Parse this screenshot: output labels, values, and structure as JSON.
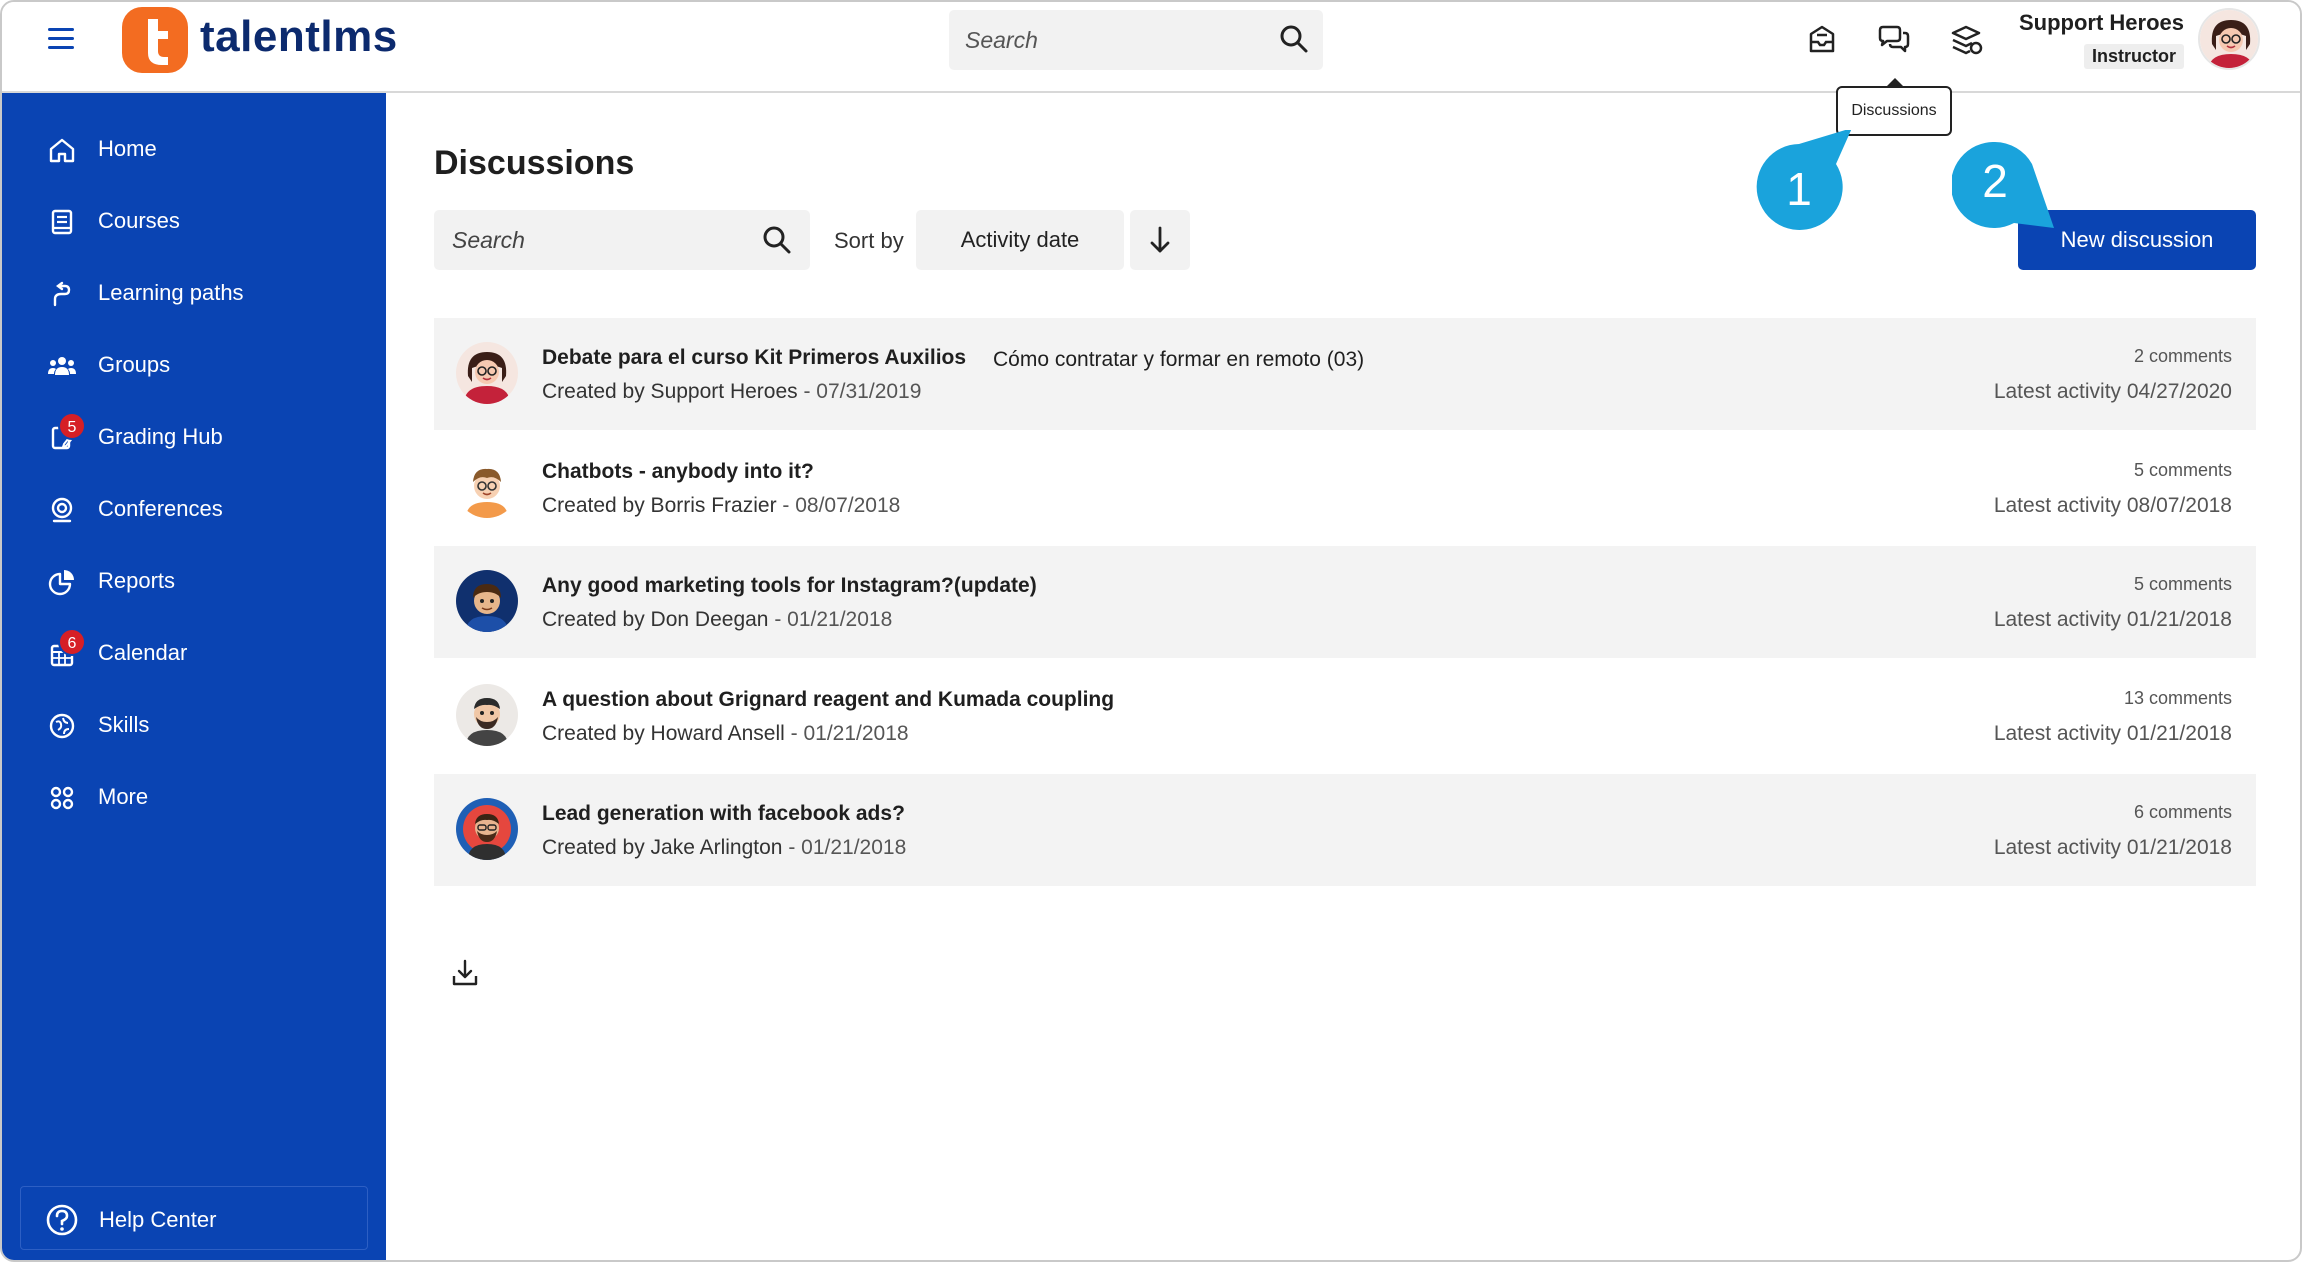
{
  "header": {
    "brand": "talentlms",
    "search_placeholder": "Search",
    "user_name": "Support Heroes",
    "user_role": "Instructor",
    "tooltip": "Discussions"
  },
  "sidebar": {
    "items": [
      {
        "label": "Home",
        "icon": "home-icon"
      },
      {
        "label": "Courses",
        "icon": "courses-icon"
      },
      {
        "label": "Learning paths",
        "icon": "learning-paths-icon"
      },
      {
        "label": "Groups",
        "icon": "groups-icon"
      },
      {
        "label": "Grading Hub",
        "icon": "grading-hub-icon",
        "badge": "5"
      },
      {
        "label": "Conferences",
        "icon": "conferences-icon"
      },
      {
        "label": "Reports",
        "icon": "reports-icon"
      },
      {
        "label": "Calendar",
        "icon": "calendar-icon",
        "badge": "6"
      },
      {
        "label": "Skills",
        "icon": "skills-icon"
      },
      {
        "label": "More",
        "icon": "more-icon"
      }
    ],
    "help_label": "Help Center"
  },
  "main": {
    "title": "Discussions",
    "search_placeholder": "Search",
    "sort_label": "Sort by",
    "sort_value": "Activity date",
    "new_button": "New discussion",
    "callouts": [
      "1",
      "2"
    ],
    "discussions": [
      {
        "title": "Debate para el curso Kit Primeros Auxilios",
        "course": "Cómo contratar y formar en remoto (03)",
        "author": "Created by Support Heroes",
        "date": " - 07/31/2019",
        "comments": "2 comments",
        "activity": "Latest activity 04/27/2020"
      },
      {
        "title": "Chatbots - anybody into it?",
        "course": "",
        "author": "Created by Borris Frazier",
        "date": " - 08/07/2018",
        "comments": "5 comments",
        "activity": "Latest activity 08/07/2018"
      },
      {
        "title": "Any good marketing tools for Instagram?(update)",
        "course": "",
        "author": "Created by Don Deegan",
        "date": " - 01/21/2018",
        "comments": "5 comments",
        "activity": "Latest activity 01/21/2018"
      },
      {
        "title": "A question about Grignard reagent and Kumada coupling",
        "course": "",
        "author": "Created by Howard Ansell",
        "date": " - 01/21/2018",
        "comments": "13 comments",
        "activity": "Latest activity 01/21/2018"
      },
      {
        "title": "Lead generation with facebook ads?",
        "course": "",
        "author": "Created by Jake Arlington",
        "date": " - 01/21/2018",
        "comments": "6 comments",
        "activity": "Latest activity 01/21/2018"
      }
    ]
  },
  "colors": {
    "brand_blue": "#0a44b3",
    "brand_orange": "#f36c21",
    "callout": "#1aa3dc",
    "badge": "#d61f26"
  }
}
